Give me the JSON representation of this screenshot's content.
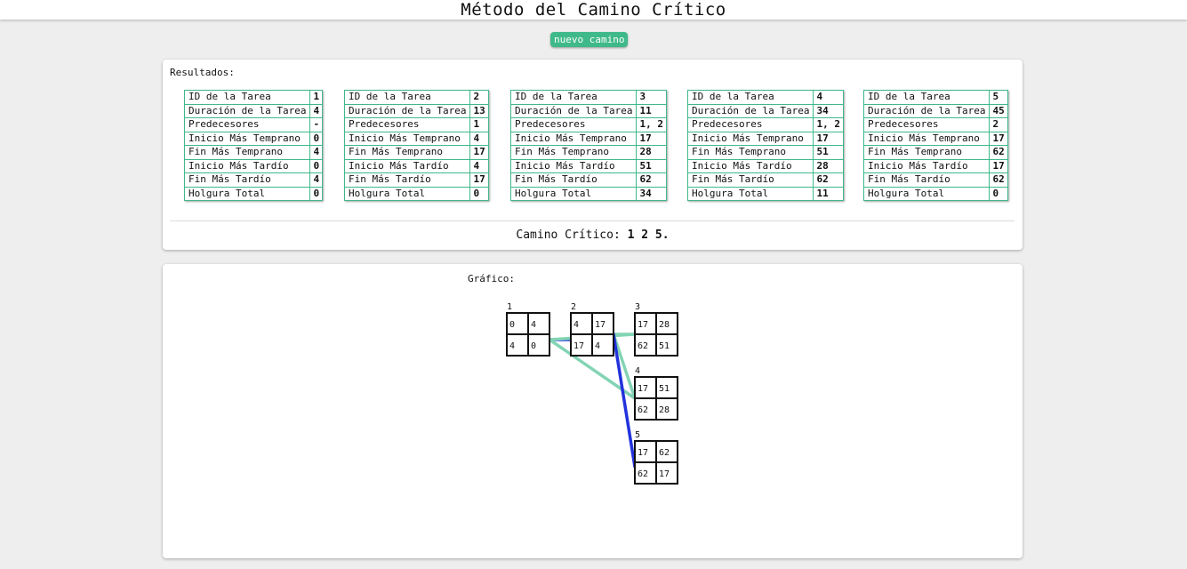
{
  "header": {
    "title": "Método del Camino Crítico"
  },
  "actions": {
    "new_path": "nuevo camino"
  },
  "results": {
    "label": "Resultados:",
    "row_labels": [
      "ID de la Tarea",
      "Duración de la Tarea",
      "Predecesores",
      "Inicio Más Temprano",
      "Fin Más Temprano",
      "Inicio Más Tardío",
      "Fin Más Tardío",
      "Holgura Total"
    ],
    "tasks": [
      {
        "values": [
          "1",
          "4",
          "-",
          "0",
          "4",
          "0",
          "4",
          "0"
        ]
      },
      {
        "values": [
          "2",
          "13",
          "1",
          "4",
          "17",
          "4",
          "17",
          "0"
        ]
      },
      {
        "values": [
          "3",
          "11",
          "1, 2",
          "17",
          "28",
          "51",
          "62",
          "34"
        ]
      },
      {
        "values": [
          "4",
          "34",
          "1, 2",
          "17",
          "51",
          "28",
          "62",
          "11"
        ]
      },
      {
        "values": [
          "5",
          "45",
          "2",
          "17",
          "62",
          "17",
          "62",
          "0"
        ]
      }
    ],
    "critical_label": "Camino Crítico:",
    "critical_value": "1 2 5."
  },
  "graph": {
    "label": "Gráfico:",
    "nodes": [
      {
        "id": "1",
        "es": "0",
        "ef": "4",
        "ls": "4",
        "lf": "0"
      },
      {
        "id": "2",
        "es": "4",
        "ef": "17",
        "ls": "17",
        "lf": "4"
      },
      {
        "id": "3",
        "es": "17",
        "ef": "28",
        "ls": "62",
        "lf": "51"
      },
      {
        "id": "4",
        "es": "17",
        "ef": "51",
        "ls": "62",
        "lf": "28"
      },
      {
        "id": "5",
        "es": "17",
        "ef": "62",
        "ls": "62",
        "lf": "17"
      }
    ],
    "edges": [
      {
        "from": "1",
        "to": "2",
        "critical": true
      },
      {
        "from": "1",
        "to": "3",
        "critical": false
      },
      {
        "from": "1",
        "to": "4",
        "critical": false
      },
      {
        "from": "2",
        "to": "3",
        "critical": false
      },
      {
        "from": "2",
        "to": "4",
        "critical": false
      },
      {
        "from": "2",
        "to": "5",
        "critical": true
      }
    ]
  },
  "colors": {
    "accent": "#3fb98a",
    "critical_edge": "#2233dd",
    "normal_edge": "#82d4b4"
  }
}
